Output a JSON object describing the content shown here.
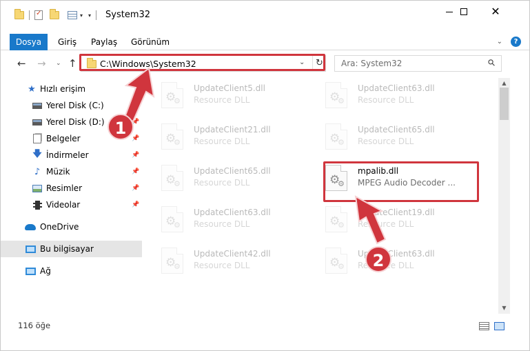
{
  "window": {
    "title": "System32"
  },
  "ribbon": {
    "tabs": [
      "Dosya",
      "Giriş",
      "Paylaş",
      "Görünüm"
    ]
  },
  "nav": {
    "address": "C:\\Windows\\System32",
    "search_placeholder": "Ara: System32"
  },
  "sidebar": {
    "items": [
      {
        "label": "Hızlı erişim",
        "icon": "star-icon",
        "pinned": false
      },
      {
        "label": "Yerel Disk (C:)",
        "icon": "drive-icon",
        "pinned": true
      },
      {
        "label": "Yerel Disk (D:)",
        "icon": "drive-icon",
        "pinned": true
      },
      {
        "label": "Belgeler",
        "icon": "documents-icon",
        "pinned": true
      },
      {
        "label": "İndirmeler",
        "icon": "downloads-icon",
        "pinned": true
      },
      {
        "label": "Müzik",
        "icon": "music-icon",
        "pinned": true
      },
      {
        "label": "Resimler",
        "icon": "pictures-icon",
        "pinned": true
      },
      {
        "label": "Videolar",
        "icon": "videos-icon",
        "pinned": true
      },
      {
        "label": "OneDrive",
        "icon": "onedrive-icon",
        "pinned": false
      },
      {
        "label": "Bu bilgisayar",
        "icon": "this-pc-icon",
        "pinned": false
      },
      {
        "label": "Ağ",
        "icon": "network-icon",
        "pinned": false
      }
    ]
  },
  "files": [
    {
      "name": "UpdateClient5.dll",
      "desc": "Resource DLL"
    },
    {
      "name": "UpdateClient63.dll",
      "desc": "Resource DLL"
    },
    {
      "name": "UpdateClient21.dll",
      "desc": "Resource DLL"
    },
    {
      "name": "UpdateClient65.dll",
      "desc": "Resource DLL"
    },
    {
      "name": "UpdateClient65.dll",
      "desc": "Resource DLL"
    },
    {
      "name": "mpalib.dll",
      "desc": "MPEG Audio Decoder ..."
    },
    {
      "name": "UpdateClient63.dll",
      "desc": "Resource DLL"
    },
    {
      "name": "UpdateClient19.dll",
      "desc": "Resource DLL"
    },
    {
      "name": "UpdateClient42.dll",
      "desc": "Resource DLL"
    },
    {
      "name": "UpdateClient63.dll",
      "desc": "Resource DLL"
    }
  ],
  "status": {
    "count": "116 öğe"
  },
  "callouts": [
    "1",
    "2"
  ],
  "colors": {
    "accent": "#1979ca",
    "highlight": "#d0353d"
  }
}
